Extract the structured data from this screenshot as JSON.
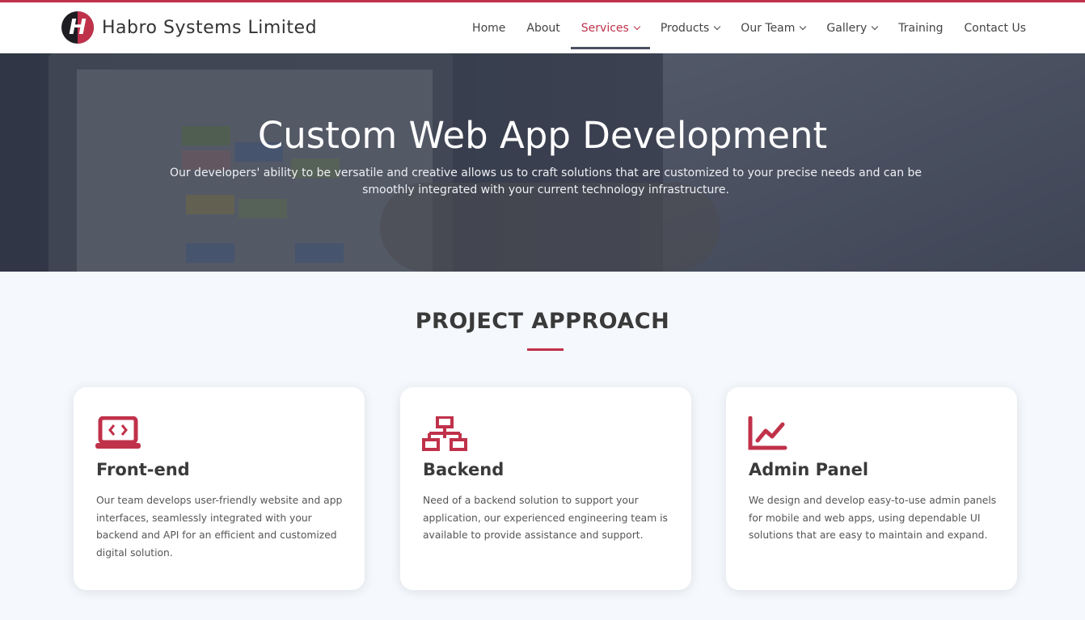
{
  "brand": {
    "name": "Habro Systems Limited",
    "logo_letter": "H",
    "accent_color": "#c0314a"
  },
  "nav": {
    "items": [
      {
        "label": "Home",
        "dropdown": false,
        "active": false
      },
      {
        "label": "About",
        "dropdown": false,
        "active": false
      },
      {
        "label": "Services",
        "dropdown": true,
        "active": true
      },
      {
        "label": "Products",
        "dropdown": true,
        "active": false
      },
      {
        "label": "Our Team",
        "dropdown": true,
        "active": false
      },
      {
        "label": "Gallery",
        "dropdown": true,
        "active": false
      },
      {
        "label": "Training",
        "dropdown": false,
        "active": false
      },
      {
        "label": "Contact Us",
        "dropdown": false,
        "active": false
      }
    ]
  },
  "hero": {
    "title": "Custom Web App Development",
    "subtitle": "Our developers' ability to be versatile and creative allows us to craft solutions that are customized to your precise needs and can be smoothly integrated with your current technology infrastructure."
  },
  "approach": {
    "title": "PROJECT APPROACH",
    "cards": [
      {
        "icon": "laptop-code-icon",
        "title": "Front-end",
        "text": "Our team develops user-friendly website and app interfaces, seamlessly integrated with your backend and API for an efficient and customized digital solution."
      },
      {
        "icon": "network-icon",
        "title": "Backend",
        "text": "Need of a backend solution to support your application, our experienced engineering team is available to provide assistance and support."
      },
      {
        "icon": "chart-line-icon",
        "title": "Admin Panel",
        "text": "We design and develop easy-to-use admin panels for mobile and web apps, using dependable UI solutions that are easy to maintain and expand."
      }
    ]
  }
}
